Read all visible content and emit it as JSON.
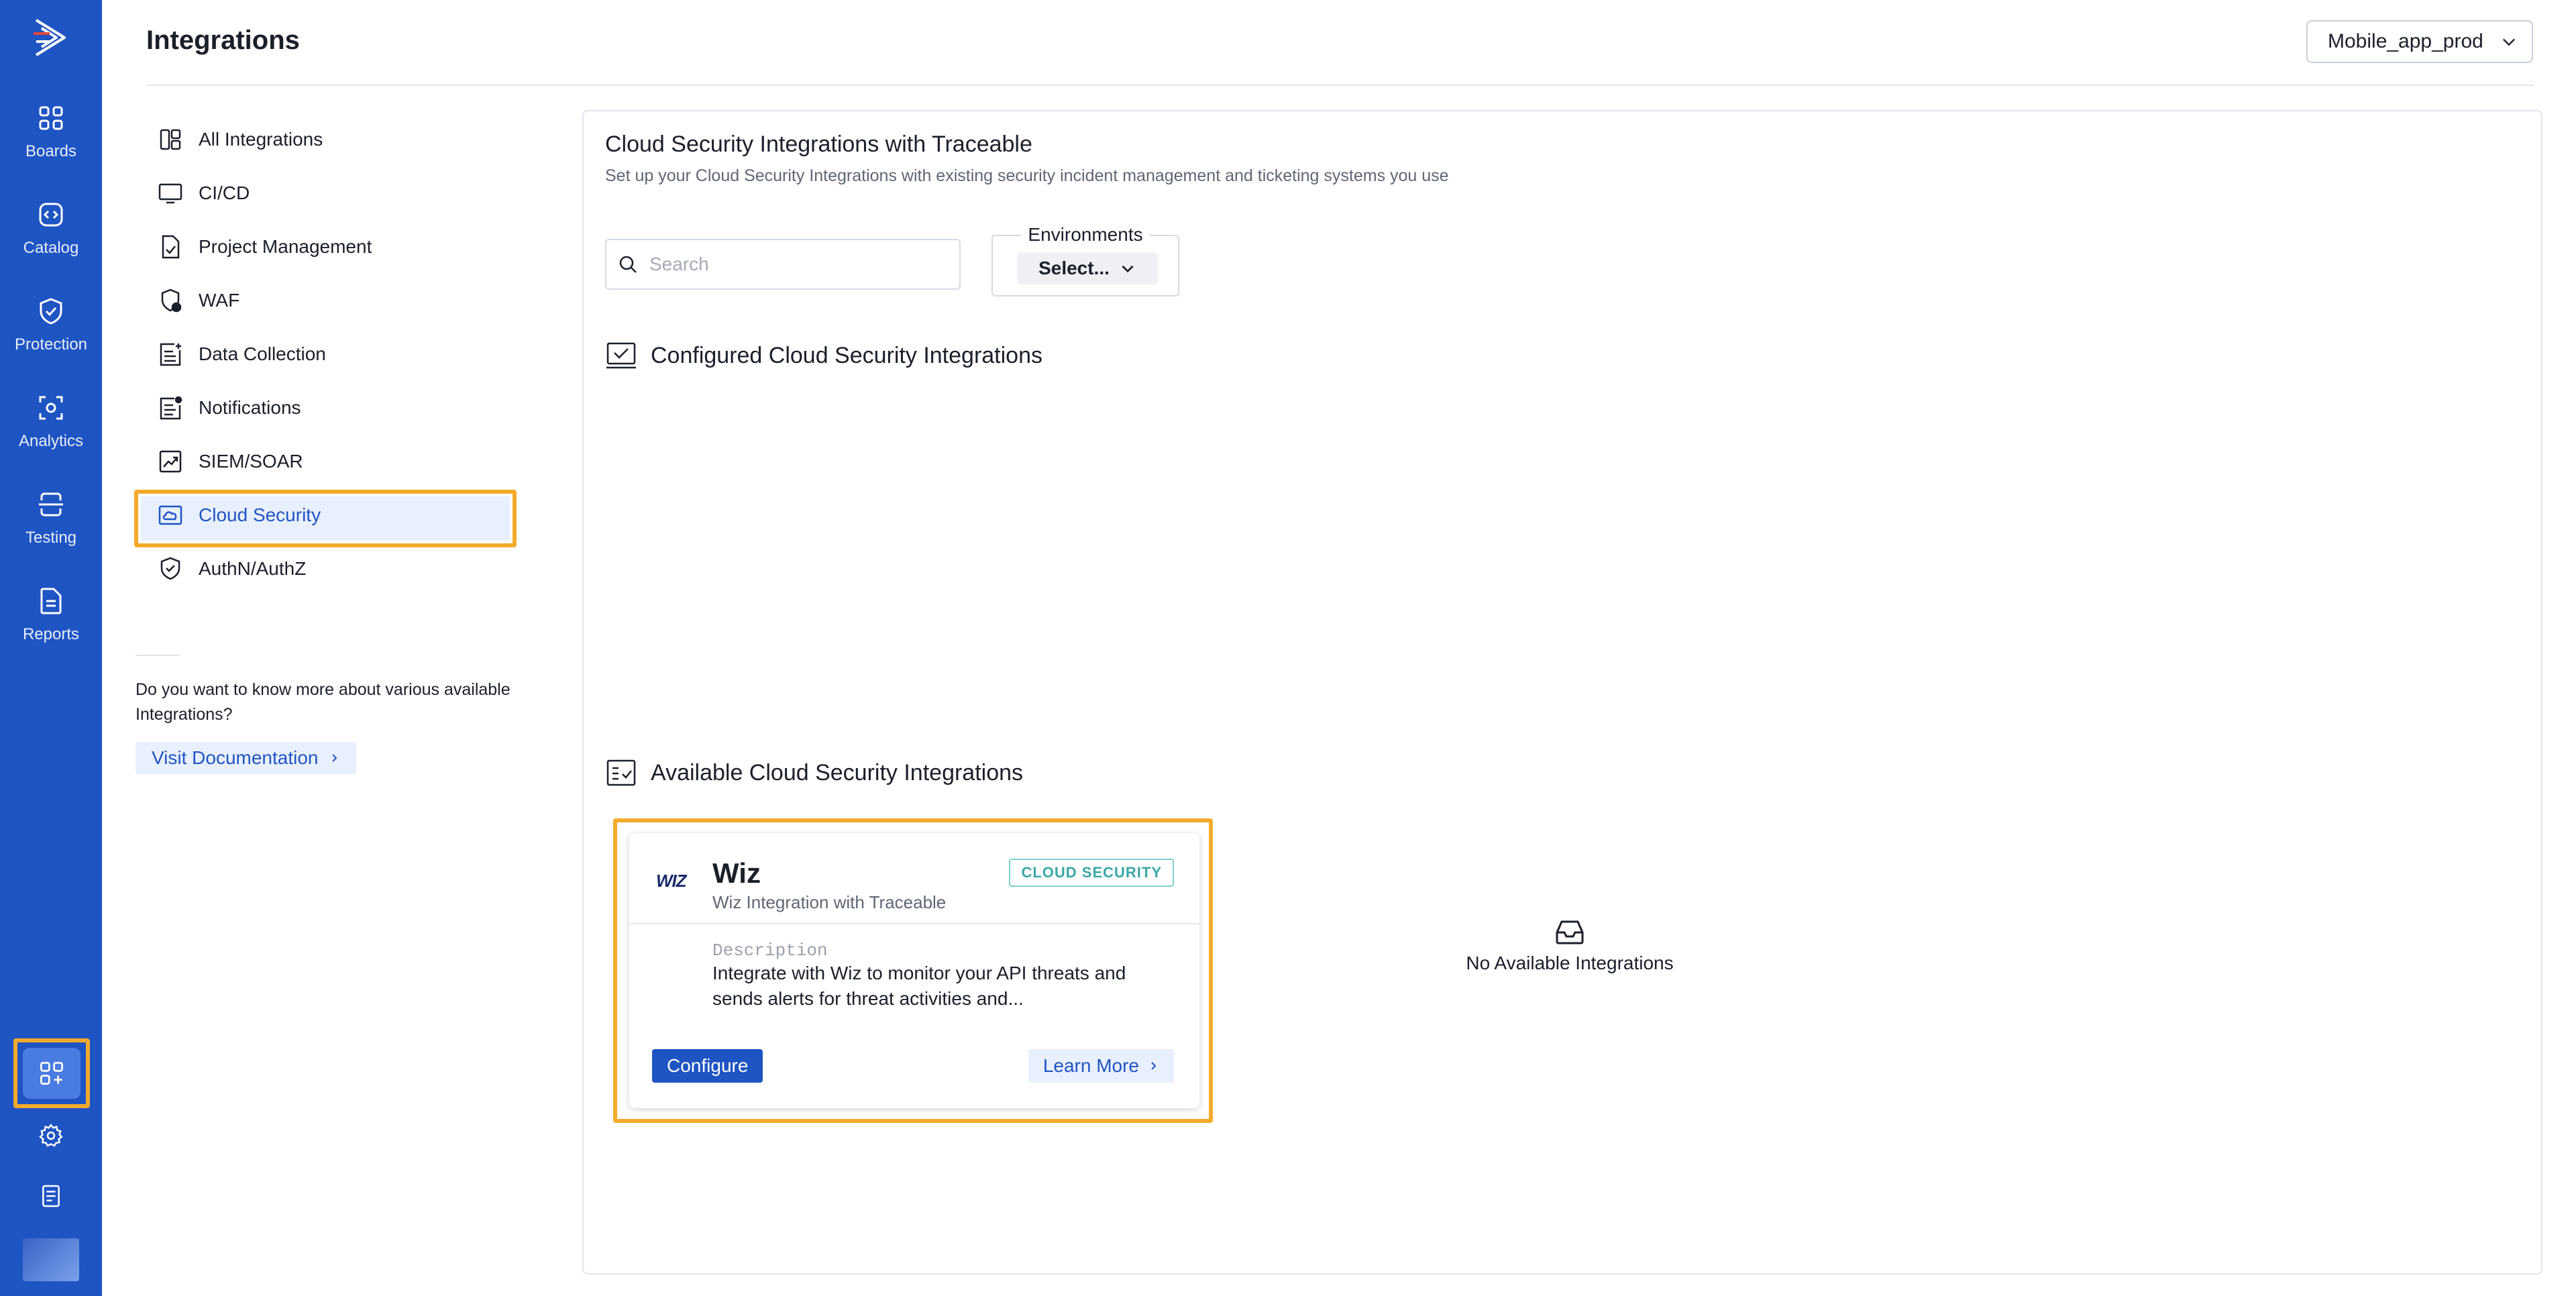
{
  "rail": {
    "items": [
      {
        "label": "Boards",
        "icon": "boards-icon"
      },
      {
        "label": "Catalog",
        "icon": "catalog-icon"
      },
      {
        "label": "Protection",
        "icon": "shield-icon"
      },
      {
        "label": "Analytics",
        "icon": "analytics-icon"
      },
      {
        "label": "Testing",
        "icon": "testing-icon"
      },
      {
        "label": "Reports",
        "icon": "reports-icon"
      }
    ],
    "bottom": [
      {
        "icon": "integrations-icon",
        "active": true
      },
      {
        "icon": "gear-icon"
      },
      {
        "icon": "docs-icon"
      }
    ],
    "accent": "#1f54c3",
    "highlight": "#f4aa2a"
  },
  "header": {
    "title": "Integrations",
    "environment": "Mobile_app_prod"
  },
  "nav": {
    "items": [
      {
        "label": "All Integrations",
        "icon": "all-integrations-icon"
      },
      {
        "label": "CI/CD",
        "icon": "monitor-icon"
      },
      {
        "label": "Project Management",
        "icon": "file-check-icon"
      },
      {
        "label": "WAF",
        "icon": "waf-shield-icon"
      },
      {
        "label": "Data Collection",
        "icon": "data-collection-icon"
      },
      {
        "label": "Notifications",
        "icon": "notifications-icon"
      },
      {
        "label": "SIEM/SOAR",
        "icon": "chart-trend-icon"
      },
      {
        "label": "Cloud Security",
        "icon": "cloud-icon",
        "active": true
      },
      {
        "label": "AuthN/AuthZ",
        "icon": "shield-check-icon"
      }
    ],
    "doc_prompt": "Do you want to know more about various available Integrations?",
    "doc_link": "Visit Documentation"
  },
  "main": {
    "title": "Cloud Security Integrations with Traceable",
    "subtitle": "Set up your Cloud Security Integrations with existing security incident management and ticketing systems you use",
    "search_placeholder": "Search",
    "env_label": "Environments",
    "env_value": "Select...",
    "configured_heading": "Configured Cloud Security Integrations",
    "available_heading": "Available Cloud Security Integrations",
    "empty_text": "No Available Integrations"
  },
  "card": {
    "logo_text": "WIZ",
    "name": "Wiz",
    "tagline": "Wiz Integration with Traceable",
    "badge": "CLOUD SECURITY",
    "desc_label": "Description",
    "desc": "Integrate with Wiz to monitor your API threats and sends alerts for threat activities and...",
    "configure_label": "Configure",
    "learn_label": "Learn More"
  }
}
